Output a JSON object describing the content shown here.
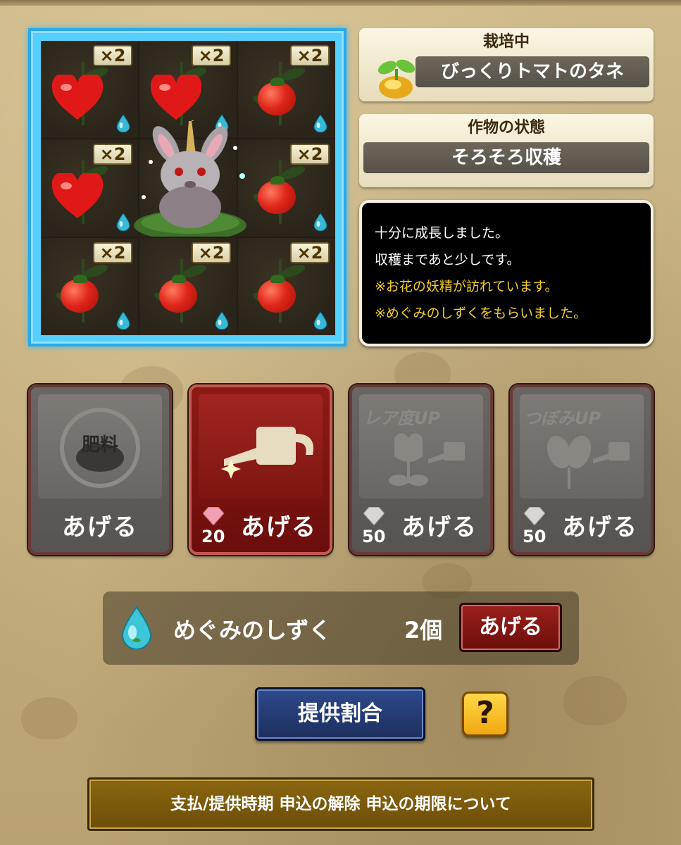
{
  "plot": {
    "cells": [
      {
        "multiplier": "×2",
        "crop": "heart",
        "has_drop": true
      },
      {
        "multiplier": "×2",
        "crop": "heart",
        "has_drop": true
      },
      {
        "multiplier": "×2",
        "crop": "tomato",
        "has_drop": true
      },
      {
        "multiplier": "×2",
        "crop": "heart",
        "has_drop": true
      },
      {
        "multiplier": "",
        "crop": "fairy",
        "has_drop": false
      },
      {
        "multiplier": "×2",
        "crop": "tomato",
        "has_drop": true
      },
      {
        "multiplier": "×2",
        "crop": "tomato",
        "has_drop": true
      },
      {
        "multiplier": "×2",
        "crop": "tomato",
        "has_drop": true
      },
      {
        "multiplier": "×2",
        "crop": "tomato",
        "has_drop": true
      }
    ],
    "border_color": "#2ba8e8"
  },
  "cultivation": {
    "header": "栽培中",
    "seed_name": "びっくりトマトのタネ",
    "icon": "seed-icon"
  },
  "crop_status": {
    "header": "作物の状態",
    "value": "そろそろ収穫"
  },
  "message": {
    "line1": "十分に成長しました。",
    "line2": "収穫まであと少しです。",
    "line3": "※お花の妖精が訪れています。",
    "line4": "※めぐみのしずくをもらいました。",
    "note_color": "#f2cc2a"
  },
  "actions": {
    "fertilizer": {
      "icon_text": "肥料",
      "label": "あげる"
    },
    "water": {
      "label": "あげる",
      "cost": "20",
      "icon": "watering-can-icon"
    },
    "rarity_up": {
      "title": "レア度UP",
      "label": "あげる",
      "cost": "50"
    },
    "bud_up": {
      "title": "つぼみUP",
      "label": "あげる",
      "cost": "50"
    }
  },
  "blessing_drop": {
    "name": "めぐみのしずく",
    "count": "2個",
    "button": "あげる"
  },
  "rate_button": "提供割合",
  "help_button": "?",
  "footer_link": "支払/提供時期 申込の解除 申込の期限について"
}
